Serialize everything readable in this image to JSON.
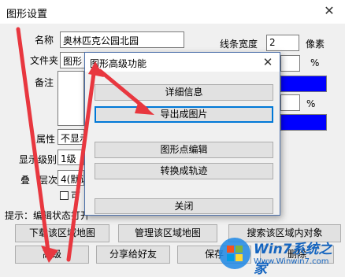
{
  "window": {
    "title": "图形设置",
    "close_glyph": "✕"
  },
  "form": {
    "name_label": "名称",
    "name_value": "奥林匹克公园北园",
    "folder_label": "文件夹",
    "folder_value": "图形",
    "note_label": "备注",
    "attr_label": "属性",
    "attr_value": "不显示",
    "display_level_label": "显示级别",
    "display_level_value": "1级",
    "overlay_label_fragment": "叠",
    "overlay_label_tail": "层次",
    "overlay_value": "4(默认",
    "checkbox_fragment": "可",
    "line_width_label": "线条宽度",
    "line_width_value": "2",
    "line_width_unit": "像素",
    "percent_unit": "%",
    "percent_unit_2": "%",
    "line_color": "#0000ff",
    "fill_color": "#0000ff"
  },
  "hint": {
    "text": "提示：编辑状态打开"
  },
  "buttons": {
    "download_region": "下载该区域地图",
    "manage_region": "管理该区域地图",
    "search_region": "搜索该区域内对象",
    "advanced": "高级",
    "share": "分享给好友",
    "save": "保存",
    "delete": "删除"
  },
  "dialog": {
    "title": "图形高级功能",
    "close_glyph": "✕",
    "details": "详细信息",
    "export_image": "导出成图片",
    "edit_points": "图形点编辑",
    "convert_track": "转换成轨迹",
    "close": "关闭"
  },
  "watermark": {
    "brand": "Win7系统之家",
    "url": "Www.Winwin7.com"
  },
  "colors": {
    "arrow": "#e8373f",
    "accent": "#0078d7",
    "dialog_border": "#4a6ea9"
  }
}
